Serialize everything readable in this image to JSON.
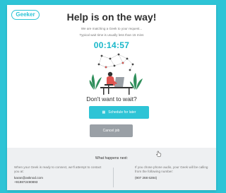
{
  "brand": {
    "logo_text": "Geeker",
    "accent_color": "#2ec4d6"
  },
  "main": {
    "title": "Help is on the way!",
    "subtitle_line1": "We are matching a Geek to your request...",
    "subtitle_line2": "Typical wait time is usually less than 15 mins",
    "timer": "00:14:57",
    "question": "Don't want to wait?",
    "schedule_button": "Schedule for later",
    "schedule_icon": "calendar-icon",
    "cancel_button": "Cancel job"
  },
  "info": {
    "title": "What happens next:",
    "left_text": "When your Geek is ready to connect, we'll attempt to contact you at:",
    "left_email": "karan@asknod.com",
    "left_phone": "+919872490893",
    "right_text": "If you chose phone audio, your Geek will be calling from the following number:",
    "right_phone": "(907 268 6284)"
  }
}
